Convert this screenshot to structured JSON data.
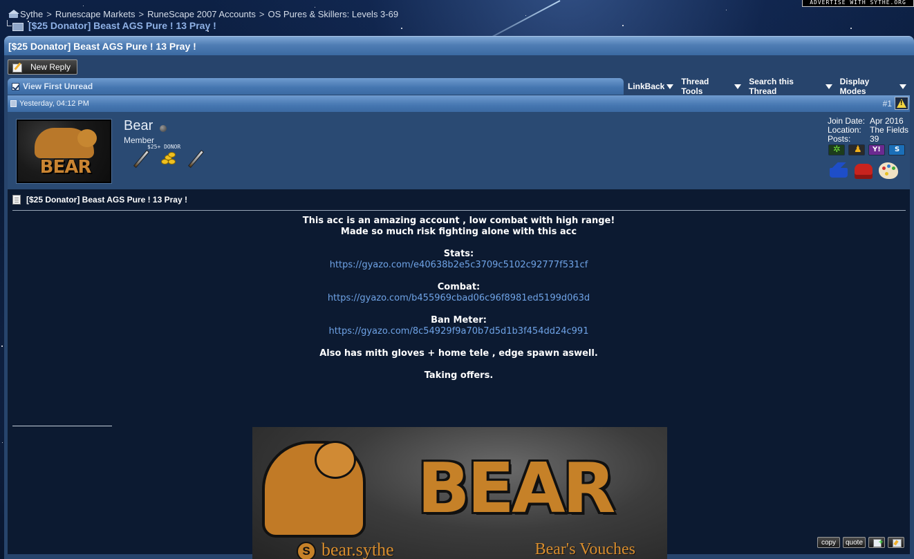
{
  "header": {
    "ad_text": "ADVERTISE WITH SYTHE.ORG"
  },
  "breadcrumb": {
    "items": [
      "Sythe",
      "Runescape Markets",
      "RuneScape 2007 Accounts",
      "OS Pures & Skillers: Levels 3-69"
    ],
    "separator": ">",
    "current": "[$25 Donator] Beast AGS Pure ! 13 Pray !"
  },
  "thread": {
    "title": "[$25 Donator] Beast AGS Pure ! 13 Pray !",
    "new_reply_label": "New Reply",
    "view_first_unread": "View First Unread",
    "tools": [
      "LinkBack",
      "Thread Tools",
      "Search this Thread",
      "Display Modes"
    ]
  },
  "post": {
    "date": "Yesterday, 04:12 PM",
    "number": "#1",
    "user": {
      "name": "Bear",
      "title": "Member",
      "donor_label": "$25+ DONOR",
      "avatar_text": "BEAR",
      "stats": [
        {
          "label": "Join Date:",
          "value": "Apr 2016"
        },
        {
          "label": "Location:",
          "value": "The Fields"
        },
        {
          "label": "Posts:",
          "value": "39"
        }
      ],
      "status": "offline"
    },
    "title": "[$25 Donator] Beast AGS Pure ! 13 Pray !",
    "message": {
      "line1": "This acc is an amazing account , low combat with high range!",
      "line2": "Made so much risk fighting alone with this acc",
      "stats_label": "Stats:",
      "stats_link": "https://gyazo.com/e40638b2e5c3709c5102c92777f531cf",
      "combat_label": "Combat:",
      "combat_link": "https://gyazo.com/b455969cbad06c96f8981ed5199d063d",
      "ban_label": "Ban Meter:",
      "ban_link": "https://gyazo.com/8c54929f9a70b7d5d1b3f454dd24c991",
      "line3": "Also has mith gloves + home tele , edge spawn aswell.",
      "line4": "Taking offers."
    },
    "signature": {
      "banner_word": "BEAR",
      "skype_letter": "S",
      "skype_name": "bear.sythe",
      "vouches": "Bear's Vouches"
    },
    "buttons": {
      "copy": "copy",
      "quote": "quote"
    }
  },
  "colors": {
    "title_bar": "#4f7db4",
    "panel": "#27446c",
    "post_body": "#0c1a31",
    "link": "#6fa3e6",
    "accent_orange": "#c68128"
  }
}
